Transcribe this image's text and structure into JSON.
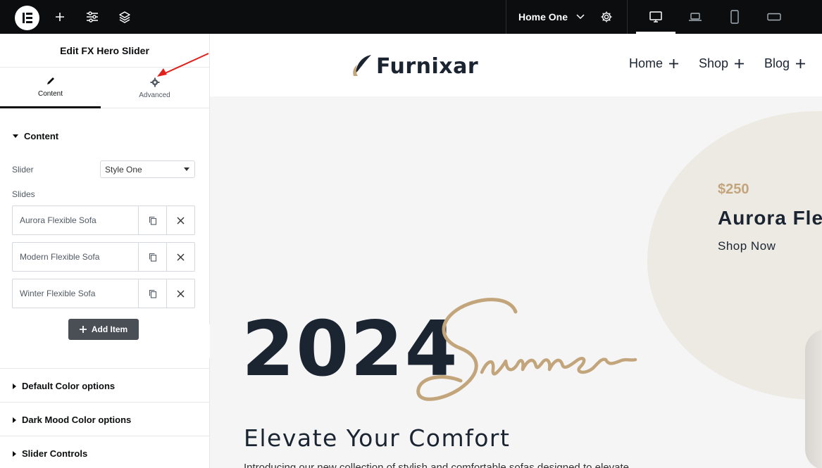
{
  "topbar": {
    "logo_icon": "elementor-logo-icon",
    "add_icon": "plus-icon",
    "settings_icon": "sliders-icon",
    "structure_icon": "layers-icon",
    "page_name": "Home One",
    "page_settings_icon": "gear-icon",
    "devices": [
      "desktop-icon",
      "laptop-icon",
      "tablet-icon",
      "mobile-landscape-icon"
    ]
  },
  "panel": {
    "title": "Edit FX Hero Slider",
    "tabs": [
      {
        "label": "Content",
        "icon": "pencil-icon",
        "active": true
      },
      {
        "label": "Advanced",
        "icon": "gear-icon",
        "active": false
      }
    ],
    "content_section": {
      "heading": "Content",
      "slider_label": "Slider",
      "slider_value": "Style One",
      "slides_label": "Slides",
      "slides": [
        "Aurora Flexible Sofa",
        "Modern Flexible Sofa",
        "Winter Flexible Sofa"
      ],
      "add_item_label": "Add Item"
    },
    "collapsed_sections": [
      "Default Color options",
      "Dark Mood Color options",
      "Slider Controls"
    ]
  },
  "preview": {
    "brand": "Furnixar",
    "nav": [
      "Home",
      "Shop",
      "Blog"
    ],
    "slide": {
      "price": "$250",
      "product_name": "Aurora Fle",
      "cta": "Shop Now",
      "year": "2024",
      "script_word": "Summer",
      "headline": "Elevate Your Comfort",
      "subline": "Introducing our new collection of stylish and comfortable sofas designed to elevate"
    }
  },
  "colors": {
    "topbar_bg": "#0c0d0e",
    "accent_gold": "#c3a57c",
    "heading_dark": "#1b2431",
    "annotation_arrow": "#e0201b"
  }
}
